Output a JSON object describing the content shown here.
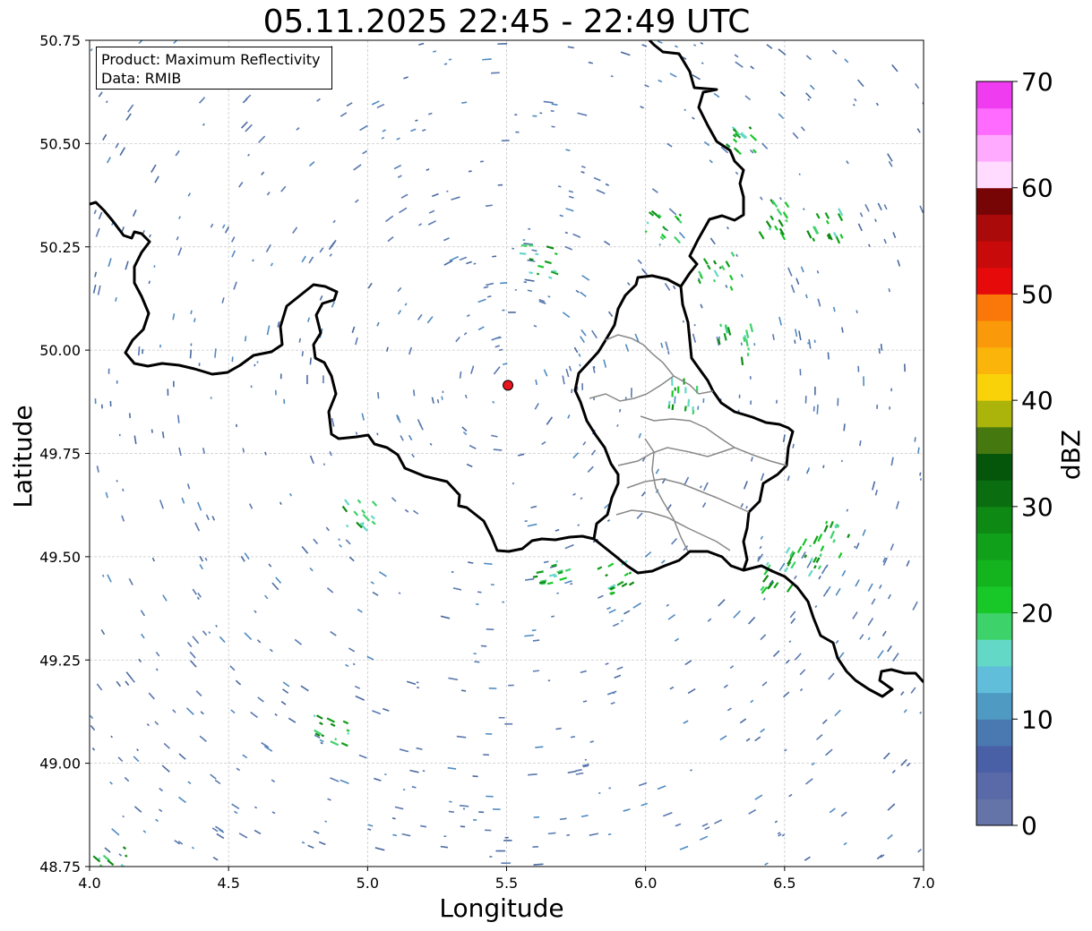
{
  "title": "05.11.2025 22:45 - 22:49 UTC",
  "info_box": {
    "product": "Product: Maximum Reflectivity",
    "data": "Data: RMIB"
  },
  "axes": {
    "xlabel": "Longitude",
    "ylabel": "Latitude",
    "xlim": [
      4.0,
      7.0
    ],
    "ylim": [
      48.75,
      50.75
    ],
    "xticks": [
      "4.0",
      "4.5",
      "5.0",
      "5.5",
      "6.0",
      "6.5",
      "7.0"
    ],
    "yticks": [
      "50.75",
      "50.50",
      "50.25",
      "50.00",
      "49.75",
      "49.50",
      "49.25",
      "49.00",
      "48.75"
    ],
    "grid": true
  },
  "radar_site": {
    "lon": 5.505,
    "lat": 49.915,
    "color": "#e8141e"
  },
  "colorbar": {
    "label": "dBZ",
    "ticks": [
      "0",
      "10",
      "20",
      "30",
      "40",
      "50",
      "60",
      "70"
    ],
    "range": [
      0,
      70
    ],
    "colors": [
      "#6474a8",
      "#5a6aa8",
      "#4a60a6",
      "#4a78b0",
      "#4f9ac3",
      "#60bedb",
      "#64d8c6",
      "#3ed26a",
      "#18c828",
      "#14b41e",
      "#10a01a",
      "#0e8a14",
      "#0a6e10",
      "#05560a",
      "#467810",
      "#aab40a",
      "#fad20a",
      "#fab40a",
      "#fa9a0a",
      "#fa780a",
      "#e60a0a",
      "#c80a0a",
      "#aa0a0a",
      "#780505",
      "#ffdcff",
      "#ffaaff",
      "#ff6aff",
      "#f03cf0"
    ]
  }
}
